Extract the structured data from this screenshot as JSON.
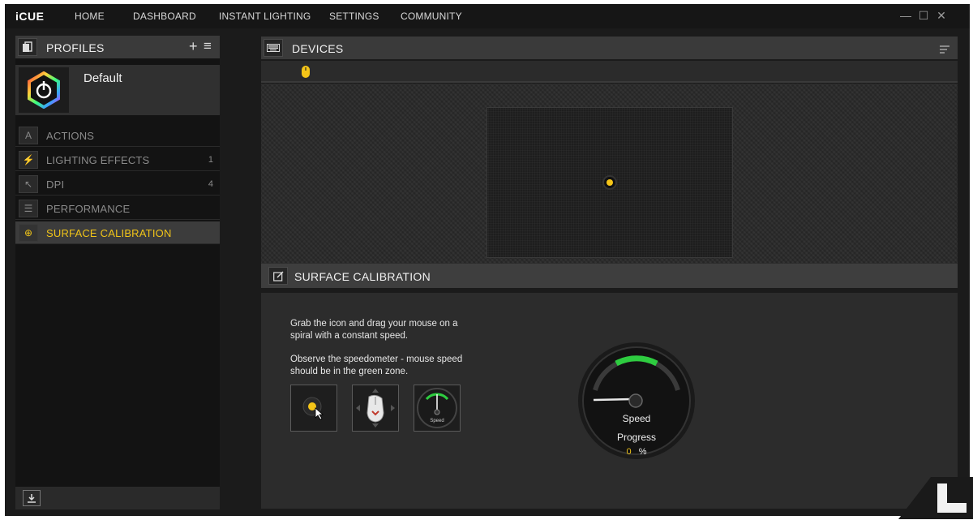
{
  "app": {
    "logo": "iCUE"
  },
  "nav": [
    "HOME",
    "DASHBOARD",
    "INSTANT LIGHTING",
    "SETTINGS",
    "COMMUNITY"
  ],
  "window_controls": {
    "minimize": "—",
    "maximize": "☐",
    "close": "✕"
  },
  "profiles": {
    "title": "PROFILES",
    "add_label": "+",
    "menu_label": "≡",
    "current": "Default"
  },
  "menu": [
    {
      "label": "ACTIONS",
      "count": "",
      "icon": "A"
    },
    {
      "label": "LIGHTING EFFECTS",
      "count": "1",
      "icon": "⚡"
    },
    {
      "label": "DPI",
      "count": "4",
      "icon": "↖"
    },
    {
      "label": "PERFORMANCE",
      "count": "",
      "icon": "☰"
    },
    {
      "label": "SURFACE CALIBRATION",
      "count": "",
      "icon": "⊕"
    }
  ],
  "devices": {
    "title": "DEVICES"
  },
  "calibration": {
    "title": "SURFACE CALIBRATION",
    "instruction_1": "Grab the icon and drag your mouse on a spiral with a constant speed.",
    "instruction_2": "Observe the speedometer - mouse speed should be in the green zone.",
    "step3_label": "Speed",
    "gauge_label": "Speed",
    "progress_label": "Progress",
    "progress_value": "0",
    "progress_unit": "%"
  },
  "colors": {
    "accent": "#f0c419",
    "green": "#2ecc40",
    "background": "#1b1b1b"
  }
}
